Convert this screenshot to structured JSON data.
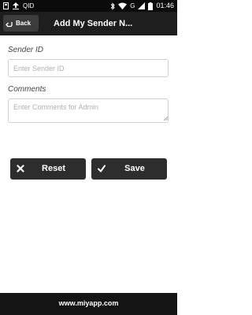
{
  "status_bar": {
    "left_text": "QID",
    "network_label": "G",
    "time": "01:46",
    "icons": [
      "upload-icon",
      "bluetooth-icon",
      "wifi-icon",
      "signal-icon",
      "battery-icon"
    ]
  },
  "app_bar": {
    "back_label": "Back",
    "title": "Add My Sender N..."
  },
  "form": {
    "sender_id": {
      "label": "Sender ID",
      "placeholder": "Enter Sender ID",
      "value": ""
    },
    "comments": {
      "label": "Comments",
      "placeholder": "Enter Comments for Admin",
      "value": ""
    }
  },
  "actions": {
    "reset_label": "Reset",
    "save_label": "Save"
  },
  "footer": {
    "text": "www.miyapp.com"
  },
  "colors": {
    "status_bar": "#0b0b0b",
    "app_bar": "#1e1e1e",
    "button": "#2d2d2d",
    "footer": "#141414"
  }
}
